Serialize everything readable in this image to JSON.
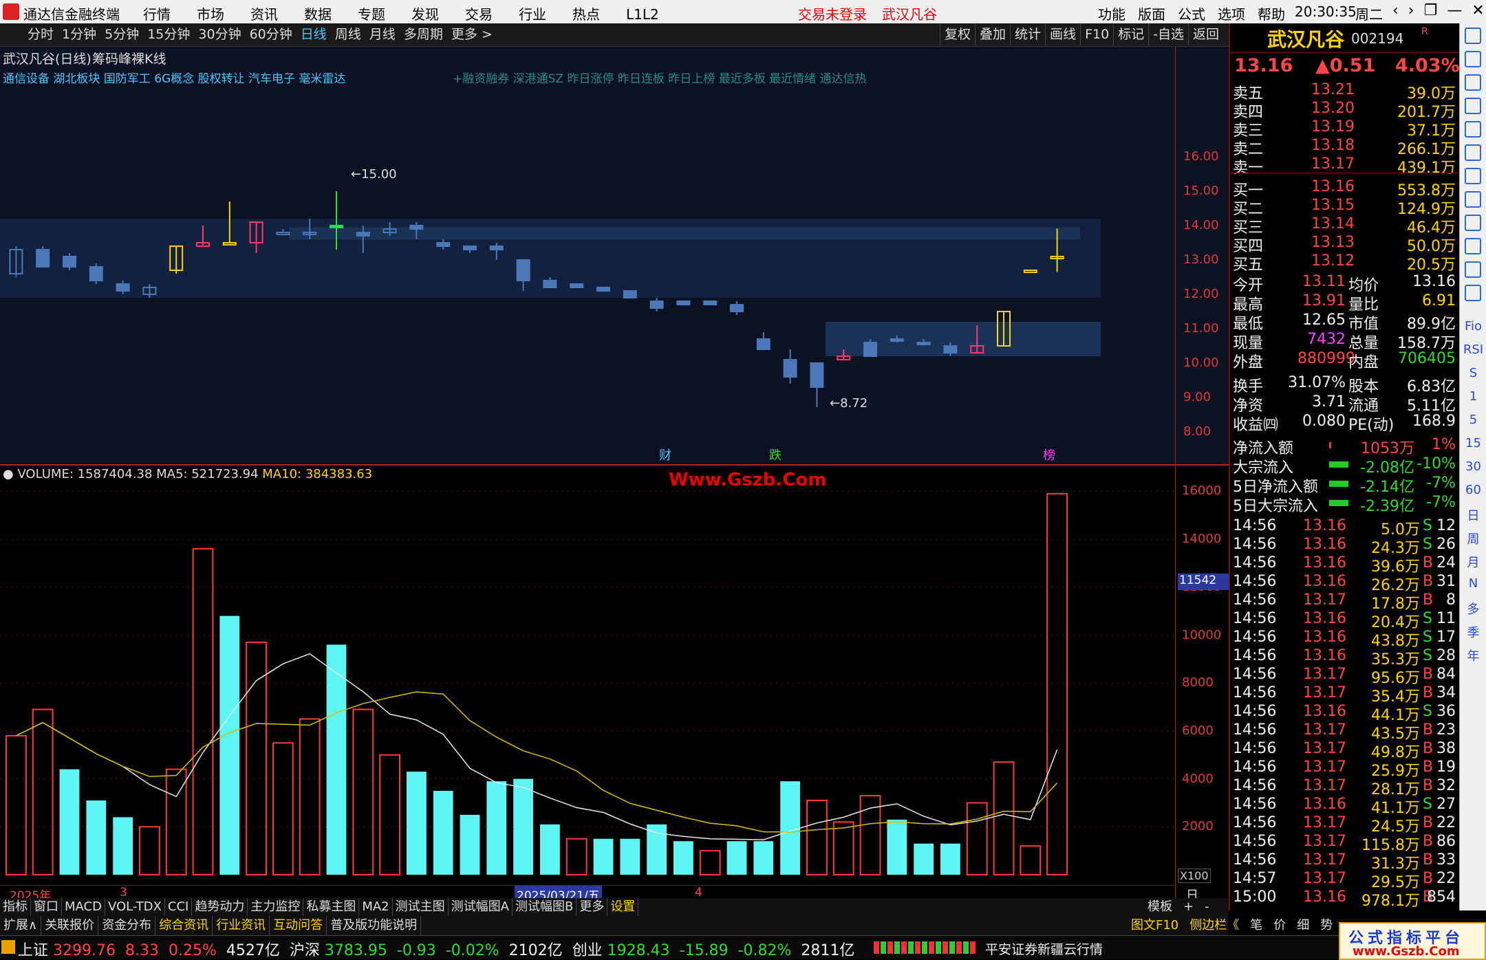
{
  "titlebar": {
    "app": "通达信金融终端",
    "menus": [
      "行情",
      "市场",
      "资讯",
      "数据",
      "专题",
      "发现",
      "交易",
      "行业",
      "热点",
      "L1L2"
    ],
    "notice": "交易未登录",
    "stock": "武汉凡谷",
    "right_menus": [
      "功能",
      "版面",
      "公式",
      "选项",
      "帮助"
    ],
    "time": "20:30:35",
    "weekday": "周二"
  },
  "periods": [
    "分时",
    "1分钟",
    "5分钟",
    "15分钟",
    "30分钟",
    "60分钟",
    "日线",
    "周线",
    "月线",
    "多周期",
    "更多 >"
  ],
  "toolbar": [
    "复权",
    "叠加",
    "统计",
    "画线",
    "F10",
    "标记",
    "-自选",
    "返回"
  ],
  "chart": {
    "title": "武汉凡谷(日线)",
    "indicator": "筹码峰裸K线",
    "concepts": "通信设备 湖北板块 国防军工 6G概念 股权转让 汽车电子 毫米雷达",
    "concepts2": "+融资融券 深港通SZ 昨日涨停 昨日连板 昨日上榜 最近多板 最近情绪 通达信热",
    "high_label": "15.00",
    "low_label": "8.72",
    "markers": [
      "财",
      "跌",
      "榜"
    ],
    "price_ticks": [
      "16.00",
      "15.00",
      "14.00",
      "13.00",
      "12.00",
      "11.00",
      "10.00",
      "9.00",
      "8.00"
    ]
  },
  "volume": {
    "label": "VOLUME: 1587404.38",
    "ma5": "MA5: 521723.94",
    "ma10": "MA10: 384383.63",
    "watermark": "Www.Gszb.Com",
    "ticks": [
      "16000",
      "14000",
      "12000",
      "10000",
      "8000",
      "6000",
      "4000",
      "2000"
    ],
    "cursor": "11542",
    "unit": "X100"
  },
  "xaxis": {
    "year": "2025年",
    "m3": "3",
    "date": "2025/03/21/五",
    "m4": "4",
    "period": "日线"
  },
  "chart_data": {
    "type": "bar",
    "bars": [
      {
        "v": 5800,
        "up": 1
      },
      {
        "v": 6900,
        "up": 1
      },
      {
        "v": 4400,
        "up": 0
      },
      {
        "v": 3100,
        "up": 0
      },
      {
        "v": 2400,
        "up": 0
      },
      {
        "v": 2000,
        "up": 1
      },
      {
        "v": 4400,
        "up": 1
      },
      {
        "v": 13600,
        "up": 1
      },
      {
        "v": 10800,
        "up": 0
      },
      {
        "v": 9700,
        "up": 1
      },
      {
        "v": 5500,
        "up": 1
      },
      {
        "v": 6500,
        "up": 1
      },
      {
        "v": 9600,
        "up": 0
      },
      {
        "v": 6900,
        "up": 1
      },
      {
        "v": 5000,
        "up": 1
      },
      {
        "v": 4300,
        "up": 0
      },
      {
        "v": 3500,
        "up": 0
      },
      {
        "v": 2500,
        "up": 0
      },
      {
        "v": 3900,
        "up": 0
      },
      {
        "v": 4000,
        "up": 0
      },
      {
        "v": 2100,
        "up": 0
      },
      {
        "v": 1500,
        "up": 1
      },
      {
        "v": 1500,
        "up": 0
      },
      {
        "v": 1500,
        "up": 0
      },
      {
        "v": 2100,
        "up": 0
      },
      {
        "v": 1400,
        "up": 0
      },
      {
        "v": 1000,
        "up": 1
      },
      {
        "v": 1400,
        "up": 0
      },
      {
        "v": 1400,
        "up": 0
      },
      {
        "v": 3900,
        "up": 0
      },
      {
        "v": 3100,
        "up": 1
      },
      {
        "v": 2200,
        "up": 1
      },
      {
        "v": 3300,
        "up": 1
      },
      {
        "v": 2300,
        "up": 0
      },
      {
        "v": 1300,
        "up": 0
      },
      {
        "v": 1300,
        "up": 0
      },
      {
        "v": 3000,
        "up": 1
      },
      {
        "v": 4700,
        "up": 1
      },
      {
        "v": 1200,
        "up": 1
      },
      {
        "v": 15900,
        "up": 1
      }
    ],
    "ylim": [
      0,
      16500
    ]
  },
  "quote": {
    "name": "武汉凡谷",
    "code": "002194",
    "price": "13.16",
    "change": "▲0.51",
    "pct": "4.03%",
    "asks": [
      [
        "卖五",
        "13.21",
        "39.0万"
      ],
      [
        "卖四",
        "13.20",
        "201.7万"
      ],
      [
        "卖三",
        "13.19",
        "37.1万"
      ],
      [
        "卖二",
        "13.18",
        "266.1万"
      ],
      [
        "卖一",
        "13.17",
        "439.1万"
      ]
    ],
    "bids": [
      [
        "买一",
        "13.16",
        "553.8万"
      ],
      [
        "买二",
        "13.15",
        "124.9万"
      ],
      [
        "买三",
        "13.14",
        "46.4万"
      ],
      [
        "买四",
        "13.13",
        "50.0万"
      ],
      [
        "买五",
        "13.12",
        "20.5万"
      ]
    ],
    "stats": [
      [
        "今开",
        "13.11",
        "均价",
        "13.16"
      ],
      [
        "最高",
        "13.91",
        "量比",
        "6.91"
      ],
      [
        "最低",
        "12.65",
        "市值",
        "89.9亿"
      ],
      [
        "现量",
        "7432",
        "总量",
        "158.7万"
      ],
      [
        "外盘",
        "880999",
        "内盘",
        "706405"
      ]
    ],
    "stats2": [
      [
        "换手",
        "31.07%",
        "股本",
        "6.83亿"
      ],
      [
        "净资",
        "3.71",
        "流通",
        "5.11亿"
      ],
      [
        "收益㈣",
        "0.080",
        "PE(动)",
        "168.9"
      ]
    ],
    "flows": [
      [
        "净流入额",
        "1053万",
        "1%"
      ],
      [
        "大宗流入",
        "-2.08亿",
        "-10%"
      ],
      [
        "5日净流入额",
        "-2.14亿",
        "-7%"
      ],
      [
        "5日大宗流入",
        "-2.39亿",
        "-7%"
      ]
    ],
    "ticks": [
      [
        "14:56",
        "13.16",
        "5.0万",
        "S",
        "12"
      ],
      [
        "14:56",
        "13.16",
        "24.3万",
        "S",
        "26"
      ],
      [
        "14:56",
        "13.16",
        "39.6万",
        "B",
        "24"
      ],
      [
        "14:56",
        "13.16",
        "26.2万",
        "B",
        "31"
      ],
      [
        "14:56",
        "13.17",
        "17.8万",
        "B",
        "8"
      ],
      [
        "14:56",
        "13.16",
        "20.4万",
        "S",
        "11"
      ],
      [
        "14:56",
        "13.16",
        "43.8万",
        "S",
        "17"
      ],
      [
        "14:56",
        "13.16",
        "35.3万",
        "S",
        "28"
      ],
      [
        "14:56",
        "13.17",
        "95.6万",
        "B",
        "84"
      ],
      [
        "14:56",
        "13.17",
        "35.4万",
        "B",
        "34"
      ],
      [
        "14:56",
        "13.16",
        "44.1万",
        "S",
        "36"
      ],
      [
        "14:56",
        "13.17",
        "43.5万",
        "B",
        "23"
      ],
      [
        "14:56",
        "13.17",
        "49.8万",
        "B",
        "38"
      ],
      [
        "14:56",
        "13.17",
        "25.9万",
        "B",
        "19"
      ],
      [
        "14:56",
        "13.17",
        "28.1万",
        "B",
        "32"
      ],
      [
        "14:56",
        "13.16",
        "41.1万",
        "S",
        "27"
      ],
      [
        "14:56",
        "13.17",
        "24.5万",
        "B",
        "22"
      ],
      [
        "14:56",
        "13.17",
        "115.8万",
        "B",
        "86"
      ],
      [
        "14:56",
        "13.17",
        "31.3万",
        "B",
        "33"
      ],
      [
        "14:57",
        "13.17",
        "29.5万",
        "B",
        "22"
      ],
      [
        "15:00",
        "13.16",
        "978.1万",
        "B",
        "854"
      ]
    ]
  },
  "bottomtabs": [
    "指标",
    "窗口",
    "MACD",
    "VOL-TDX",
    "CCI",
    "趋势动力",
    "主力监控",
    "私募主图",
    "MA2",
    "测试主图",
    "测试幅图A",
    "测试幅图B",
    "更多",
    "设置"
  ],
  "bottomright": [
    "模板",
    "+",
    "-"
  ],
  "tabs2": [
    "扩展∧",
    "关联报价",
    "资金分布",
    "综合资讯",
    "行业资讯",
    "互动问答",
    "普及版功能说明"
  ],
  "tabs2right": [
    "图文F10",
    "侧边栏《",
    "笔",
    "价",
    "细",
    "势"
  ],
  "status": {
    "sh": "上证",
    "sh_v": "3299.76",
    "sh_c": "8.33",
    "sh_p": "0.25%",
    "sh_a": "4527亿",
    "hs": "沪深",
    "hs_v": "3783.95",
    "hs_c": "-0.93",
    "hs_p": "-0.02%",
    "hs_a": "2102亿",
    "cy": "创业",
    "cy_v": "1928.43",
    "cy_c": "-15.89",
    "cy_p": "-0.82%",
    "cy_a": "2811亿",
    "broker": "平安证券新疆云行情",
    "logo": "公式指标平台",
    "logo2": "www.Gszb.Com"
  },
  "iconbar": [
    "Fio",
    "RSI",
    "S",
    "1",
    "5",
    "15",
    "30",
    "60",
    "日",
    "周",
    "月",
    "N",
    "多",
    "季",
    "年"
  ]
}
